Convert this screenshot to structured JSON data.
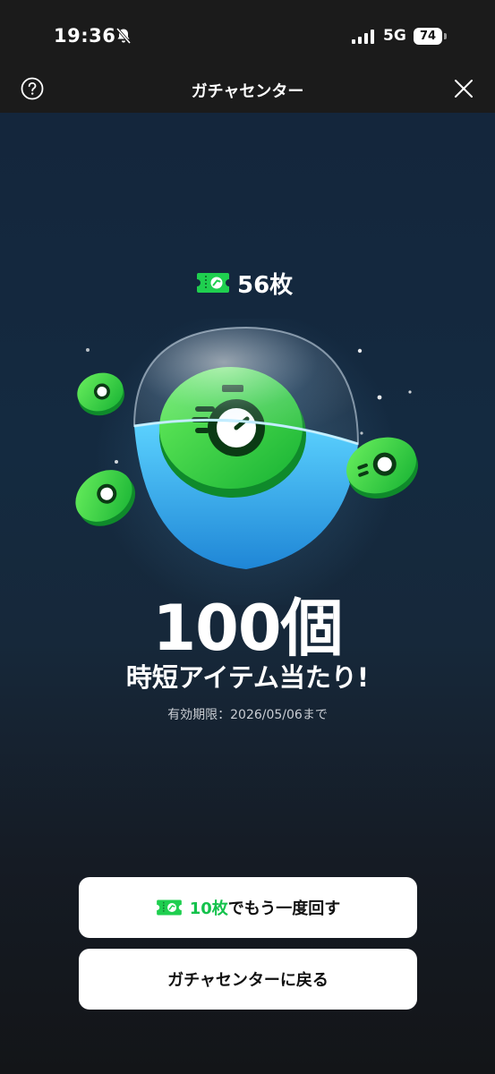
{
  "status_bar": {
    "time": "19:36",
    "network": "5G",
    "battery": "74"
  },
  "nav": {
    "title": "ガチャセンター"
  },
  "result": {
    "ticket_count": "56枚",
    "prize_amount": "100個",
    "prize_name": "時短アイテム当たり!",
    "expiry": "有効期限：2026/05/06まで"
  },
  "buttons": {
    "spin_again_count": "10枚",
    "spin_again_label": "でもう一度回す",
    "back_label": "ガチャセンターに戻る"
  },
  "colors": {
    "accent_green": "#14c24c",
    "capsule_blue": "#39b7ee",
    "coin_green": "#2fd43a"
  },
  "icons": [
    "bell-slash-icon",
    "signal-icon",
    "battery-icon",
    "help-icon",
    "close-icon",
    "ticket-icon",
    "stopwatch-icon"
  ]
}
